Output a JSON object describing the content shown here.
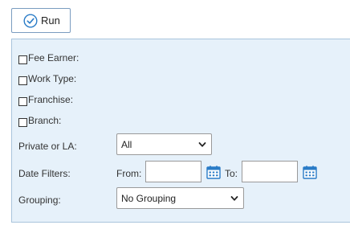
{
  "toolbar": {
    "run_label": "Run"
  },
  "filters": {
    "checkboxes": [
      {
        "label": "Fee Earner:",
        "checked": false
      },
      {
        "label": "Work Type:",
        "checked": false
      },
      {
        "label": "Franchise:",
        "checked": false
      },
      {
        "label": "Branch:",
        "checked": false
      }
    ],
    "private_or_la": {
      "label": "Private or LA:",
      "selected": "All"
    },
    "date_filters": {
      "label": "Date Filters:",
      "from_label": "From:",
      "from_value": "",
      "to_label": "To:",
      "to_value": ""
    },
    "grouping": {
      "label": "Grouping:",
      "selected": "No Grouping"
    }
  },
  "colors": {
    "panel_background": "#e6f1fa",
    "panel_border": "#a9c4dc",
    "accent": "#2a7cc7"
  },
  "icons": {
    "run": "check-circle-icon",
    "calendar": "calendar-icon",
    "dropdown": "chevron-down-icon"
  }
}
